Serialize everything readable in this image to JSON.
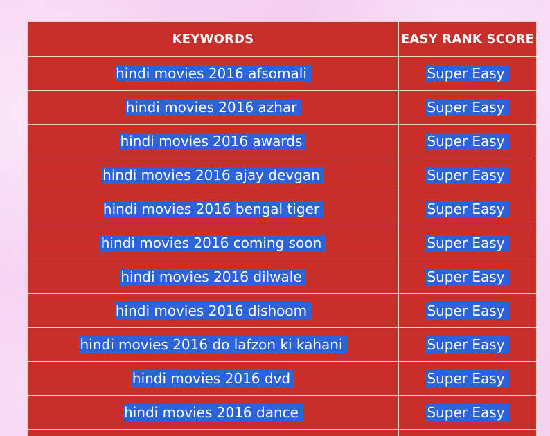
{
  "table": {
    "headers": {
      "keywords": "KEYWORDS",
      "score": "EASY RANK SCORE"
    },
    "rows": [
      {
        "keyword": "hindi movies 2016 afsomali",
        "score": "Super Easy"
      },
      {
        "keyword": "hindi movies 2016 azhar",
        "score": "Super Easy"
      },
      {
        "keyword": "hindi movies 2016 awards",
        "score": "Super Easy"
      },
      {
        "keyword": "hindi movies 2016 ajay devgan",
        "score": "Super Easy"
      },
      {
        "keyword": "hindi movies 2016 bengal tiger",
        "score": "Super Easy"
      },
      {
        "keyword": "hindi movies 2016 coming soon",
        "score": "Super Easy"
      },
      {
        "keyword": "hindi movies 2016 dilwale",
        "score": "Super Easy"
      },
      {
        "keyword": "hindi movies 2016 dishoom",
        "score": "Super Easy"
      },
      {
        "keyword": "hindi movies 2016 do lafzon ki kahani",
        "score": "Super Easy"
      },
      {
        "keyword": "hindi movies 2016 dvd",
        "score": "Super Easy"
      },
      {
        "keyword": "hindi movies 2016 dance",
        "score": "Super Easy"
      }
    ],
    "colors": {
      "table_bg": "#c72f2a",
      "selection": "#2d63d8",
      "text": "#ffffff"
    }
  }
}
